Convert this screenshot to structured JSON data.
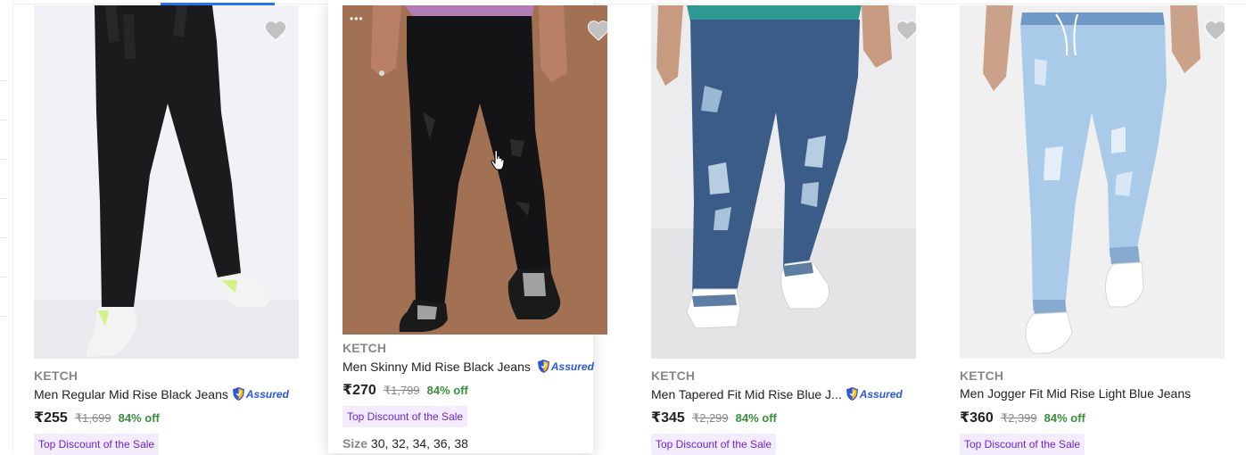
{
  "colors": {
    "accent": "#2874f0",
    "green_discount": "#388e3c",
    "purple_tag": "#6b23d5",
    "tag_bg": "#f3ecff",
    "assured_blue": "#2a55e5"
  },
  "products": [
    {
      "brand": "KETCH",
      "title": "Men Regular Mid Rise Black Jeans",
      "assured_label": "Assured",
      "price": "₹255",
      "mrp": "₹1,699",
      "discount": "84% off",
      "tag": "Top Discount of the Sale",
      "wishlist_icon": "heart-icon"
    },
    {
      "brand": "KETCH",
      "title": "Men Skinny Mid Rise Black Jeans",
      "assured_label": "Assured",
      "price": "₹270",
      "mrp": "₹1,799",
      "discount": "84% off",
      "tag": "Top Discount of the Sale",
      "size_label": "Size",
      "sizes": "30, 32, 34, 36, 38",
      "dots": "•••",
      "wishlist_icon": "heart-icon"
    },
    {
      "brand": "KETCH",
      "title": "Men Tapered Fit Mid Rise Blue J...",
      "assured_label": "Assured",
      "price": "₹345",
      "mrp": "₹2,299",
      "discount": "84% off",
      "tag": "Top Discount of the Sale",
      "wishlist_icon": "heart-icon"
    },
    {
      "brand": "KETCH",
      "title": "Men Jogger Fit Mid Rise Light Blue Jeans",
      "price": "₹360",
      "mrp": "₹2,399",
      "discount": "84% off",
      "tag": "Top Discount of the Sale",
      "wishlist_icon": "heart-icon"
    }
  ]
}
